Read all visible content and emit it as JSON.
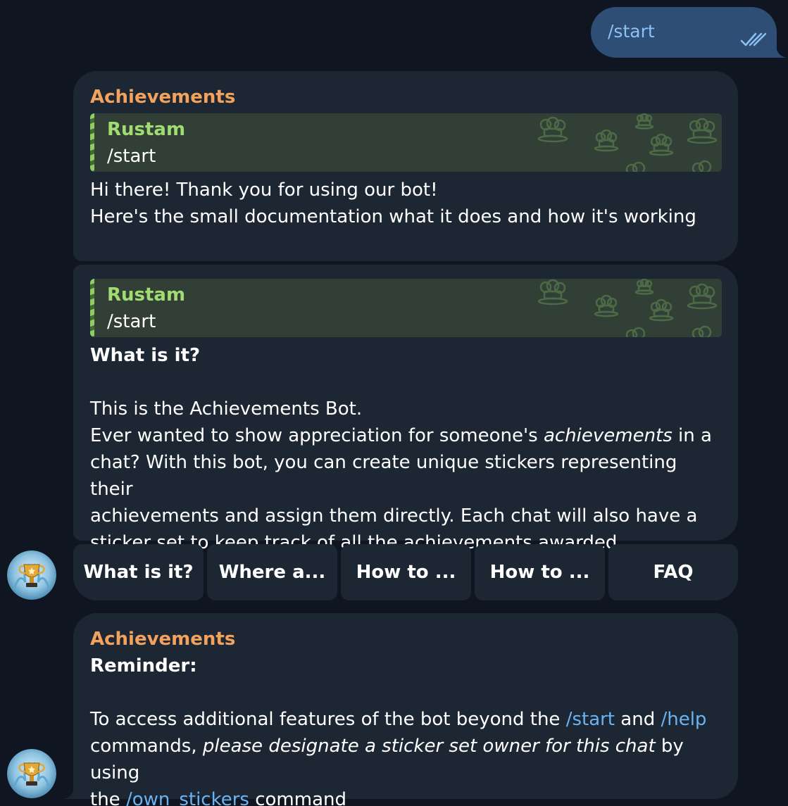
{
  "outgoing": {
    "text": "/start"
  },
  "message1": {
    "sender": "Achievements",
    "quote": {
      "name": "Rustam",
      "text": "/start"
    },
    "lines": [
      "Hi there! Thank you for using our bot!",
      "Here's the small documentation what it does and how it's working"
    ]
  },
  "message2": {
    "quote": {
      "name": "Rustam",
      "text": "/start"
    },
    "heading": "What is it?",
    "intro": "This is the Achievements Bot.",
    "p1_before": "Ever wanted to show appreciation for someone's ",
    "p1_em": "achievements",
    "p1_after": " in a",
    "p2": "chat? With this bot, you can create unique stickers representing their",
    "p3": "achievements and assign them directly. Each chat will also have a",
    "p4": "sticker set to keep track of all the achievements awarded."
  },
  "keyboard": {
    "buttons": [
      "What is it?",
      "Where a...",
      "How to ...",
      "How to ...",
      "FAQ"
    ]
  },
  "message3": {
    "sender": "Achievements",
    "heading": "Reminder:",
    "l1_before": "To access additional features of the bot beyond the ",
    "l1_link1": "/start",
    "l1_mid": " and ",
    "l1_link2": "/help",
    "l2_before": "commands, ",
    "l2_em": "please designate a sticker set owner for this chat",
    "l2_after": " by using",
    "l3_before": "the ",
    "l3_link": "/own_stickers",
    "l3_after": " command"
  },
  "colors": {
    "background": "#0f1621",
    "bubble_in": "#1d2734",
    "bubble_out": "#2e4e75",
    "sender": "#f2a25c",
    "quote_name": "#a0dc72",
    "link": "#6ab3f3"
  },
  "icons": [
    "double-check-icon",
    "bot-avatar-trophy-icon",
    "chef-hat-pattern-icon"
  ]
}
